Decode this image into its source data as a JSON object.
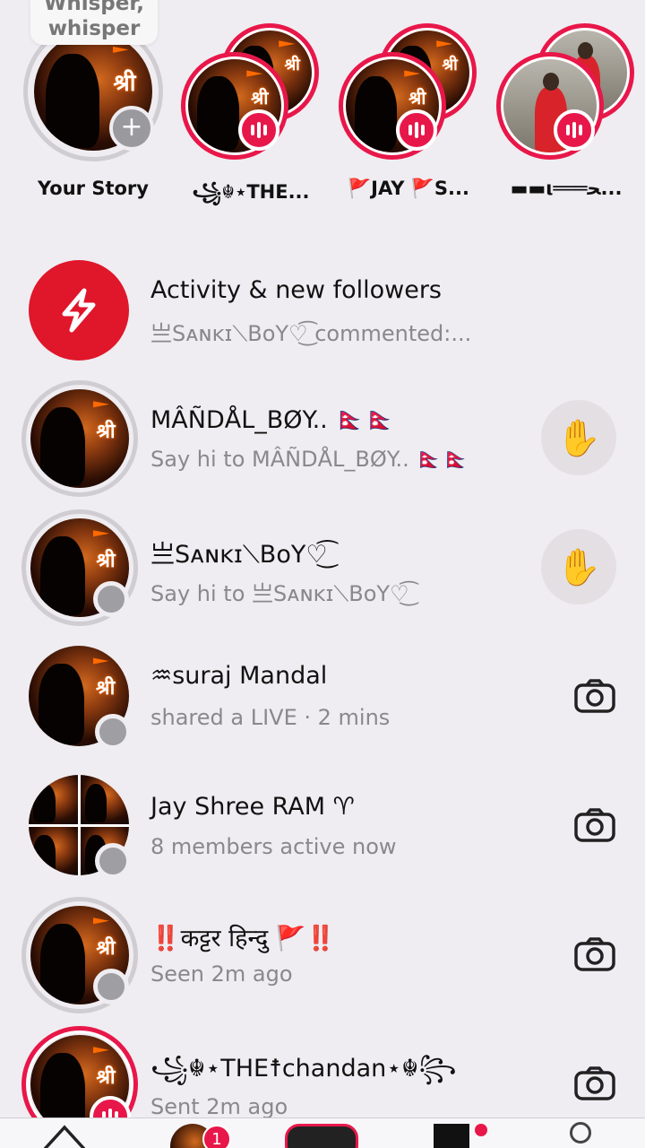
{
  "stories": {
    "whisper_bubble": "Whisper,\nwhisper",
    "whisper_line1": "Whisper,",
    "whisper_line2": "whisper",
    "items": [
      {
        "label": "Your Story"
      },
      {
        "label": "꧁☬⋆THE..."
      },
      {
        "label": "🚩JAY 🚩S..."
      },
      {
        "label": "▬▬ι═══ﺤ..."
      }
    ],
    "add_symbol": "+"
  },
  "chats": [
    {
      "title": "Activity & new followers",
      "subtitle": "亗Sᴀɴᴋɪ⟍BoY♡͜͡ commented:..."
    },
    {
      "title": "MÂÑDÅL_BØY.. 🇳🇵🇳🇵",
      "subtitle": "Say hi to MÂÑDÅL_BØY.. 🇳🇵🇳🇵",
      "action": "wave"
    },
    {
      "title": "亗Sᴀɴᴋɪ⟍BoY♡͜͡",
      "subtitle": "Say hi to 亗Sᴀɴᴋɪ⟍BoY♡͜͡",
      "action": "wave"
    },
    {
      "title": "♒suraj   Mandal",
      "subtitle": "shared a LIVE · 2 mins",
      "action": "camera"
    },
    {
      "title": "Jay Shree RAM ♈",
      "subtitle": "8 members active now",
      "action": "camera"
    },
    {
      "title": "‼️कट्टर हिन्दु 🚩‼️",
      "subtitle": "Seen 2m ago",
      "action": "camera"
    },
    {
      "title": "꧁☬⋆THE☨chandan⋆☬꧂",
      "subtitle": "Sent 2m ago",
      "action": "camera"
    }
  ],
  "bottom_nav": {
    "badge_count": "1"
  },
  "colors": {
    "accent": "#e8174a",
    "background": "#efedf1",
    "muted_text": "#8a888c"
  },
  "avatar_glyph": "श्री",
  "icons": {
    "activity": "lightning-icon",
    "wave": "waving-hand-icon",
    "camera": "camera-icon"
  }
}
